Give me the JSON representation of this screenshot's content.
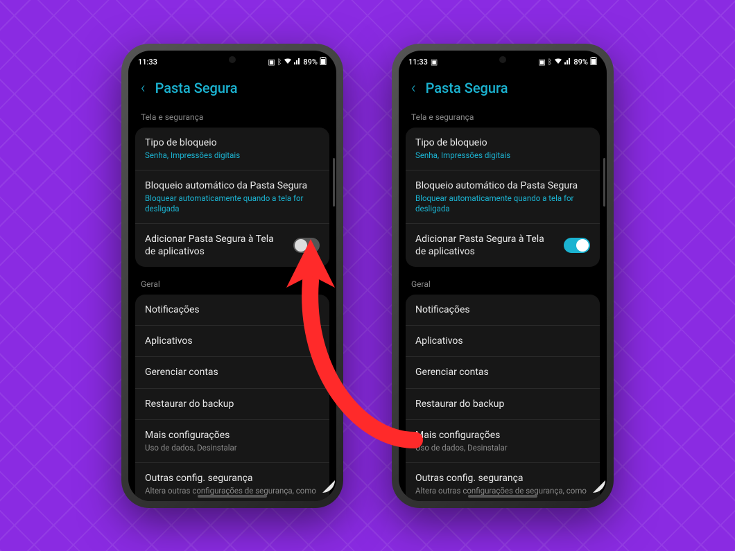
{
  "status": {
    "time": "11:33",
    "battery": "89%"
  },
  "header": {
    "title": "Pasta Segura"
  },
  "section1": {
    "label": "Tela e segurança",
    "lock_type": {
      "title": "Tipo de bloqueio",
      "sub": "Senha, Impressões digitais"
    },
    "auto_lock": {
      "title": "Bloqueio automático da Pasta Segura",
      "sub": "Bloquear automaticamente quando a tela for desligada"
    },
    "add_screen": {
      "title": "Adicionar Pasta Segura à Tela de aplicativos"
    }
  },
  "section2": {
    "label": "Geral",
    "notifications": "Notificações",
    "apps": "Aplicativos",
    "accounts": "Gerenciar contas",
    "restore": "Restaurar do backup",
    "more": {
      "title": "Mais configurações",
      "sub": "Uso de dados, Desinstalar"
    },
    "other_sec": {
      "title": "Outras config. segurança",
      "sub": "Altera outras configurações de segurança, como"
    }
  }
}
